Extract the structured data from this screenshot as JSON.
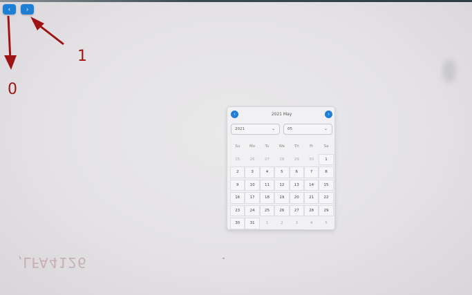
{
  "toolbar": {
    "prev_glyph": "‹",
    "next_glyph": "›",
    "prev_icon": "chevron-left-icon",
    "next_icon": "chevron-right-icon"
  },
  "annotations": {
    "label_0": "0",
    "label_1": "1",
    "color": "#9e1414"
  },
  "background_text": ",LFA4126",
  "calendar": {
    "title": "2021 May",
    "year_value": "2021",
    "month_value": "05",
    "prev_glyph": "‹",
    "next_glyph": "›",
    "dropdown_glyph": "⌄",
    "accent_color": "#1e7fd6",
    "weekdays": [
      "Su",
      "Mo",
      "Tu",
      "We",
      "Th",
      "Fr",
      "Sa"
    ],
    "weeks": [
      [
        "25",
        "26",
        "27",
        "28",
        "29",
        "30",
        "1"
      ],
      [
        "2",
        "3",
        "4",
        "5",
        "6",
        "7",
        "8"
      ],
      [
        "9",
        "10",
        "11",
        "12",
        "13",
        "14",
        "15"
      ],
      [
        "16",
        "17",
        "18",
        "19",
        "20",
        "21",
        "22"
      ],
      [
        "23",
        "24",
        "25",
        "26",
        "27",
        "28",
        "29"
      ],
      [
        "30",
        "31",
        "1",
        "2",
        "3",
        "4",
        "5"
      ]
    ]
  }
}
